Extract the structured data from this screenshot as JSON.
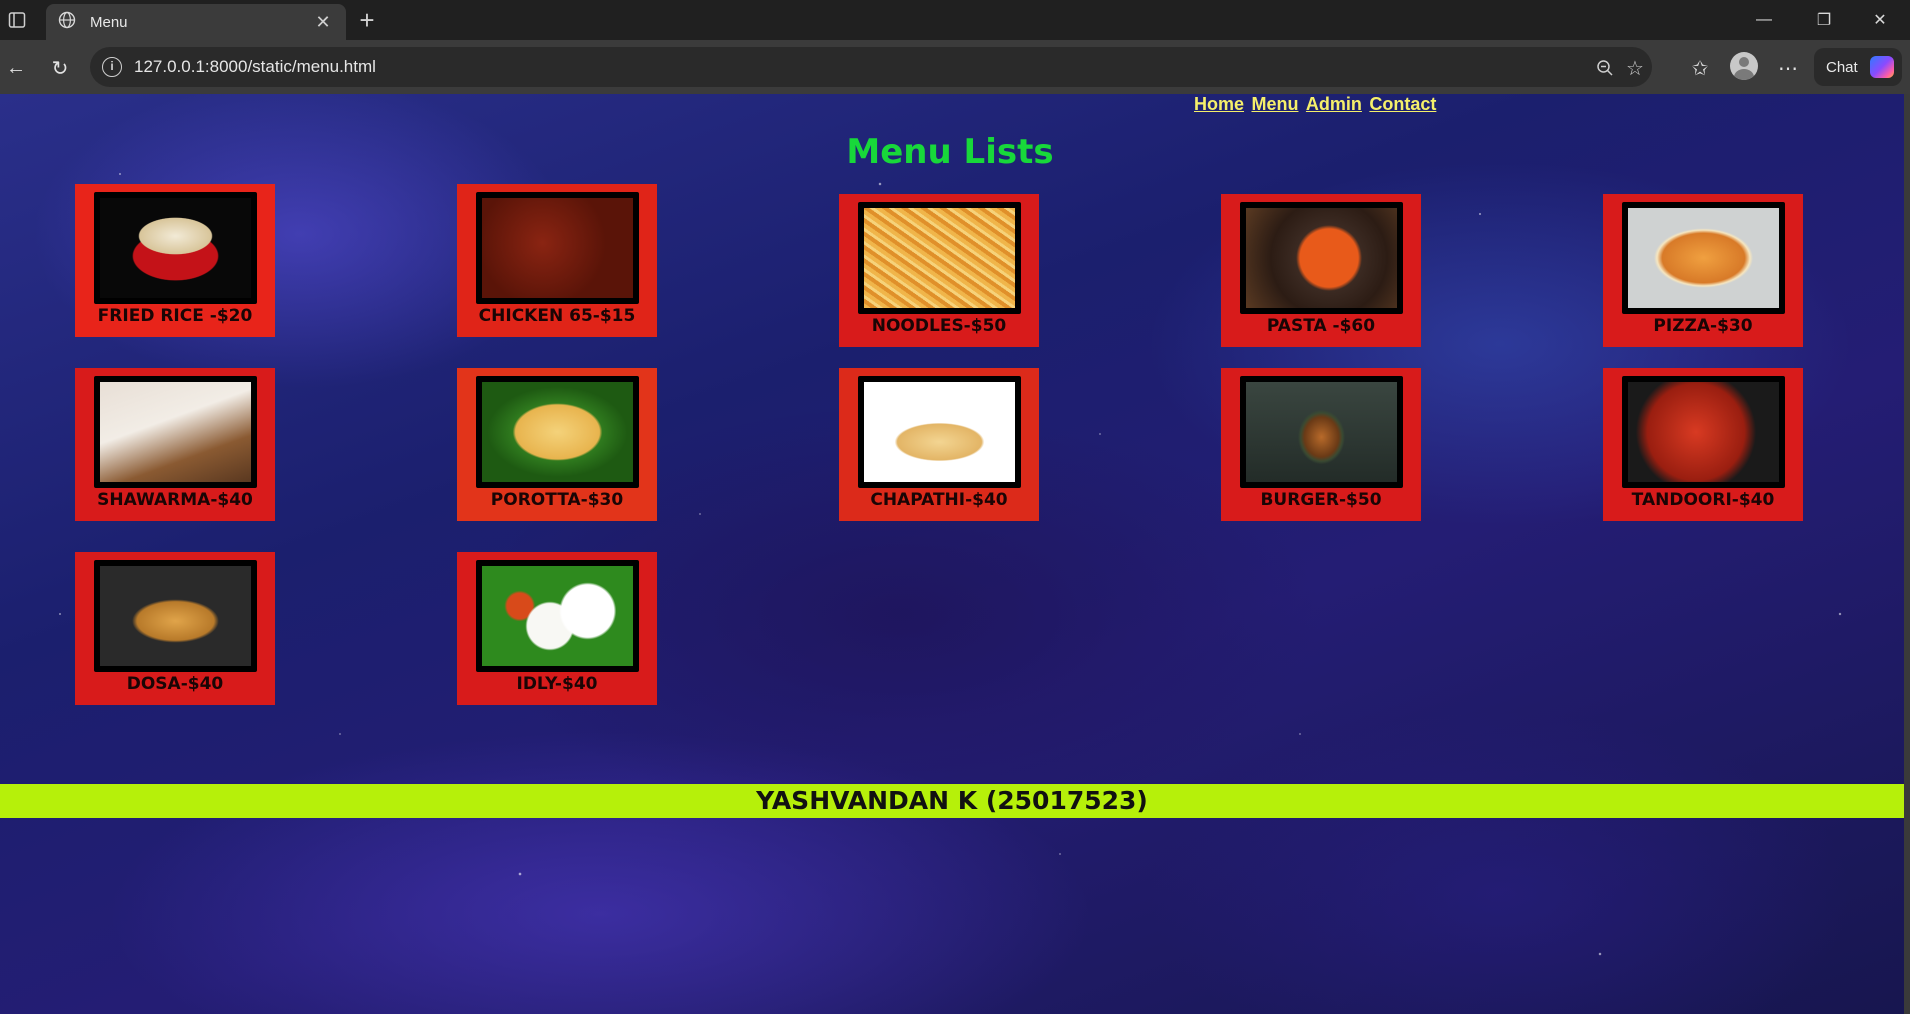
{
  "browser": {
    "tab_title": "Menu",
    "url": "127.0.0.1:8000/static/menu.html",
    "chat_label": "Chat"
  },
  "nav": {
    "links": [
      "Home",
      "Menu",
      "Admin",
      "Contact"
    ]
  },
  "page": {
    "title": "Menu Lists",
    "footer": "YASHVANDAN K (25017523)"
  },
  "colors": {
    "title": "#18d83a",
    "nav_link": "#f5ef6a",
    "card_bg": "#d81b1b",
    "footer_bg": "#b6f00a"
  },
  "menu": {
    "items": [
      {
        "label": "FRIED RICE -$20",
        "image": "fried-rice-image"
      },
      {
        "label": "CHICKEN 65-$15",
        "image": "chicken-65-image"
      },
      {
        "label": "NOODLES-$50",
        "image": "noodles-image"
      },
      {
        "label": "PASTA -$60",
        "image": "pasta-image"
      },
      {
        "label": "PIZZA-$30",
        "image": "pizza-image"
      },
      {
        "label": "SHAWARMA-$40",
        "image": "shawarma-image"
      },
      {
        "label": "POROTTA-$30",
        "image": "porotta-image"
      },
      {
        "label": "CHAPATHI-$40",
        "image": "chapathi-image"
      },
      {
        "label": "BURGER-$50",
        "image": "burger-image"
      },
      {
        "label": "TANDOORI-$40",
        "image": "tandoori-image"
      },
      {
        "label": "DOSA-$40",
        "image": "dosa-image"
      },
      {
        "label": "IDLY-$40",
        "image": "idly-image"
      }
    ]
  }
}
